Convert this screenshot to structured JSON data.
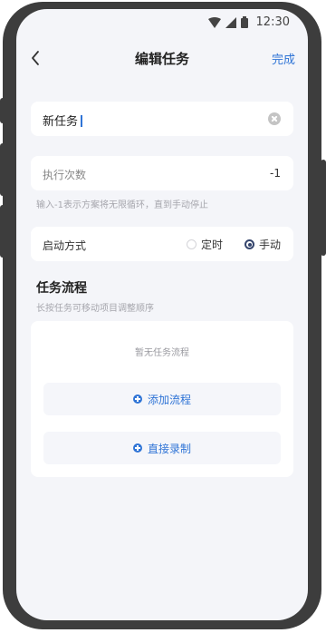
{
  "status_bar": {
    "time": "12:30",
    "icons": [
      "wifi-icon",
      "signal-icon",
      "battery-icon"
    ]
  },
  "nav": {
    "back_icon": "chevron-left-icon",
    "title": "编辑任务",
    "done_label": "完成"
  },
  "task_name": {
    "value": "新任务"
  },
  "run_count": {
    "label": "执行次数",
    "value": "-1",
    "hint": "输入-1表示方案将无限循环，直到手动停止"
  },
  "start_mode": {
    "label": "启动方式",
    "options": [
      {
        "label": "定时",
        "selected": false
      },
      {
        "label": "手动",
        "selected": true
      }
    ]
  },
  "flow": {
    "title": "任务流程",
    "subtitle": "长按任务可移动项目调整顺序",
    "empty_text": "暂无任务流程",
    "add_label": "添加流程",
    "record_label": "直接录制"
  },
  "colors": {
    "accent": "#2f74d6",
    "background": "#f4f5f9",
    "frame": "#3d3d3d",
    "radio_selected": "#35456d"
  }
}
